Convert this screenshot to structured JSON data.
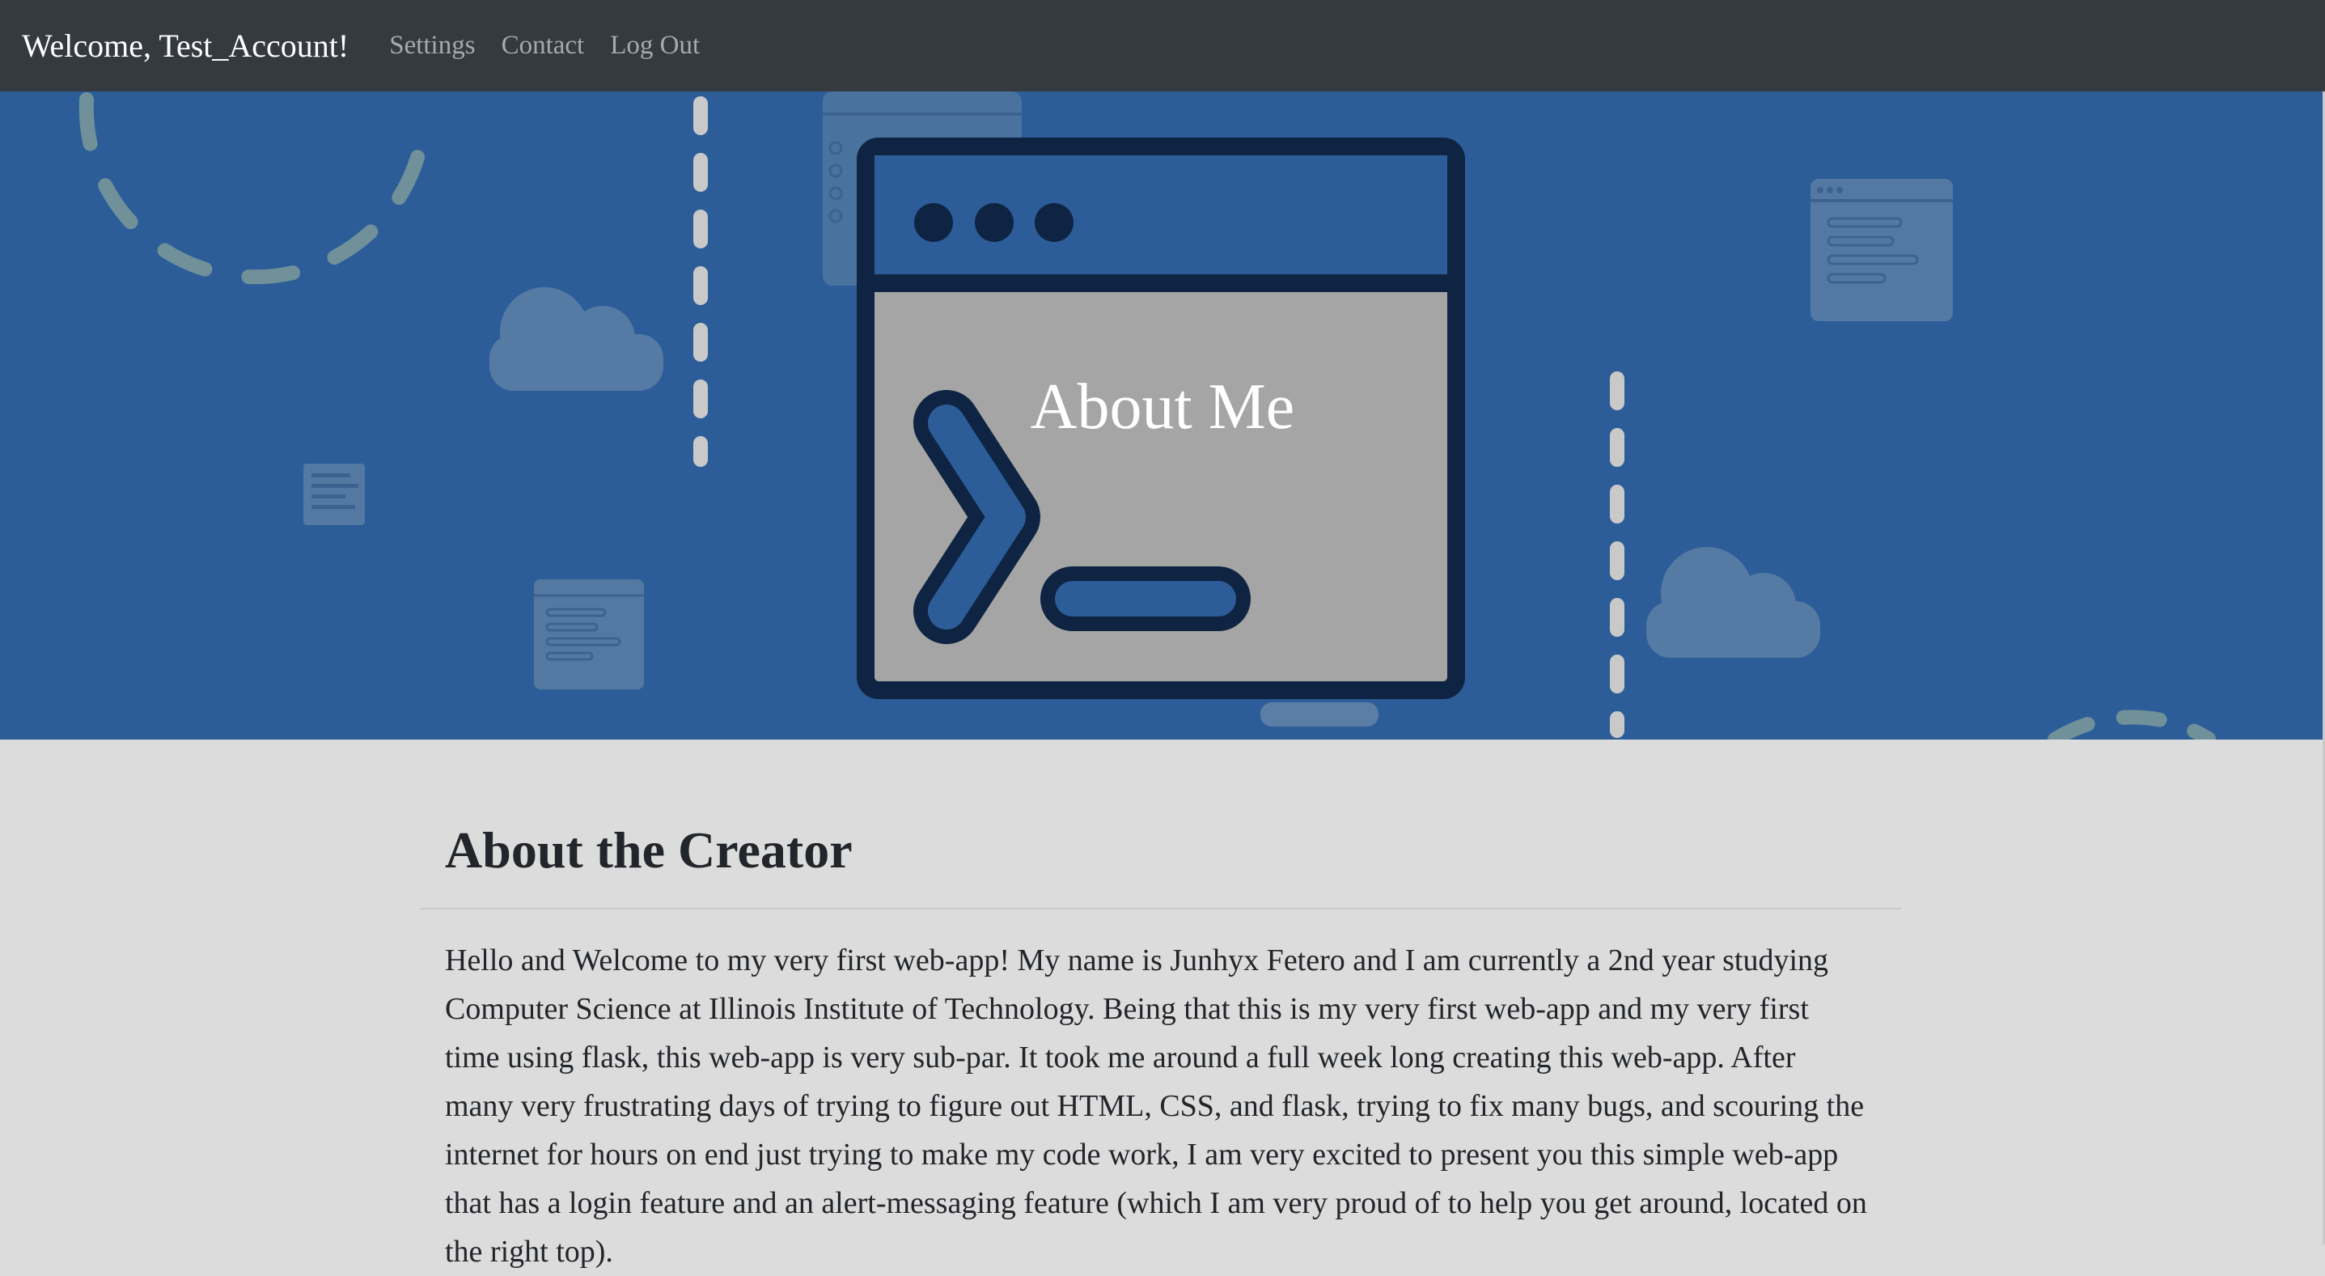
{
  "navbar": {
    "brand": "Welcome, Test_Account!",
    "links": [
      "Settings",
      "Contact",
      "Log Out"
    ]
  },
  "hero": {
    "title": "About Me"
  },
  "about": {
    "heading": "About the Creator",
    "paragraph": "Hello and Welcome to my very first web-app! My name is Junhyx Fetero and I am currently a 2nd year studying Computer Science at Illinois Institute of Technology. Being that this is my very first web-app and my very first time using flask, this web-app is very sub-par. It took me around a full week long creating this web-app. After many very frustrating days of trying to figure out HTML, CSS, and flask, trying to fix many bugs, and scouring the internet for hours on end just trying to make my code work, I am very excited to present you this simple web-app that has a login feature and an alert-messaging feature (which I am very proud of to help you get around, located on the right top)."
  },
  "colors": {
    "navbar_bg": "#343a40",
    "hero_bg": "#2c5d98",
    "page_bg": "#dcdcdc",
    "terminal_frame": "#0e2442",
    "terminal_screen": "#a5a5a5"
  },
  "icons": [
    "terminal-window-icon",
    "cloud-icon",
    "code-window-icon",
    "document-icon"
  ]
}
